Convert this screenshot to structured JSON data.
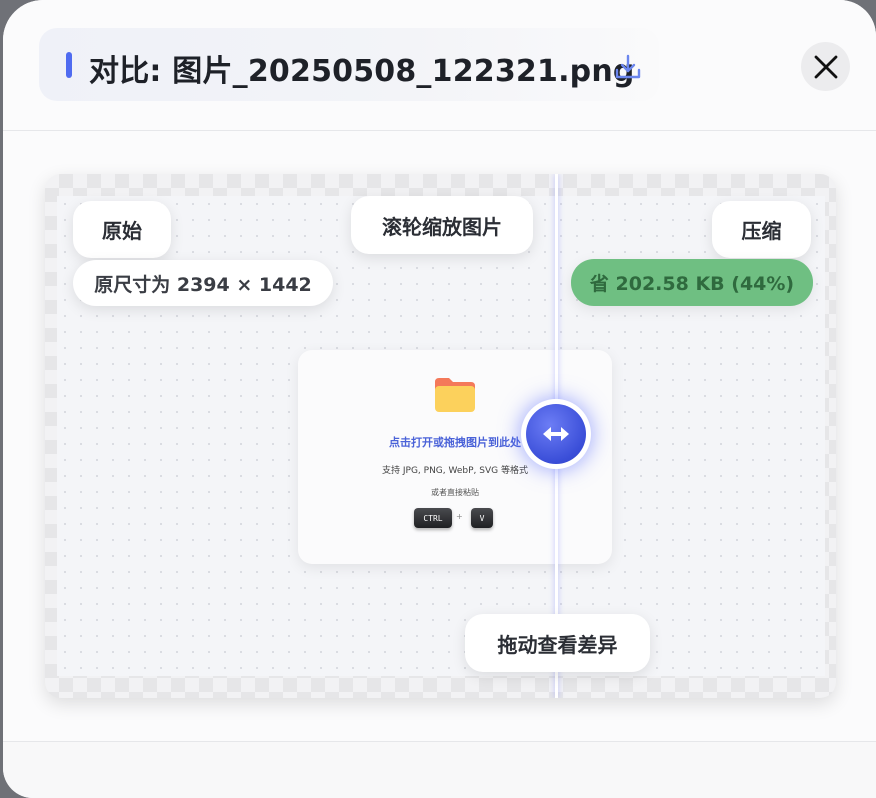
{
  "dialog": {
    "title": "对比: 图片_20250508_122321.png"
  },
  "compare": {
    "original_label": "原始",
    "compressed_label": "压缩",
    "zoom_hint": "滚轮缩放图片",
    "original_dims": "原尺寸为 2394 × 1442",
    "saved_info": "省 202.58 KB (44%)",
    "drag_hint": "拖动查看差异",
    "slider_position_percent": 64
  },
  "preview": {
    "upload_title": "点击打开或拖拽图片到此处",
    "formats": "支持 JPG, PNG, WebP, SVG 等格式",
    "paste_hint": "或者直接粘贴",
    "key_ctrl": "CTRL",
    "key_plus": "+",
    "key_v": "V"
  },
  "colors": {
    "accent": "#4f6bf0",
    "saved_bg": "#6fbf82",
    "handle": "#3a4ed8"
  },
  "icons": {
    "download": "download-icon",
    "close": "close-icon",
    "folder": "folder-icon",
    "drag": "left-right-arrows-icon"
  }
}
